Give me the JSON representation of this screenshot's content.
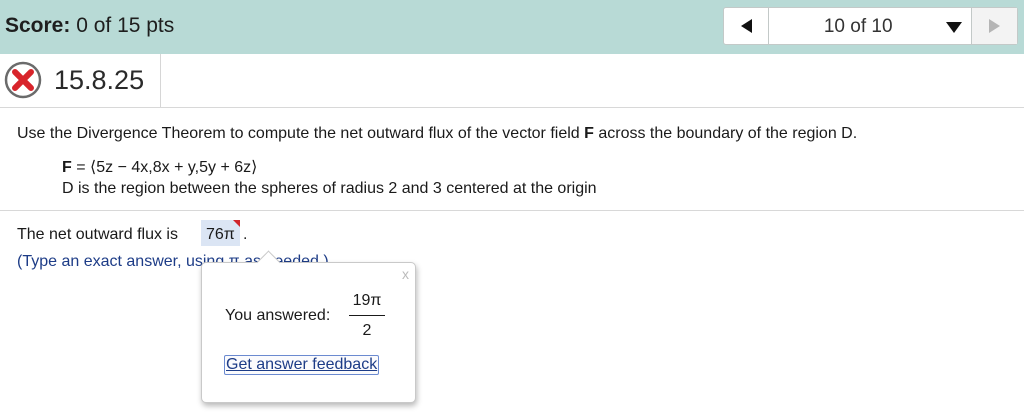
{
  "header": {
    "score_label": "Score:",
    "score_value": "0 of 15 pts",
    "question_position": "10 of 10",
    "colors": {
      "bar": "#b8dad6"
    },
    "icons": {
      "prev": "triangle-left-icon",
      "dropdown": "triangle-down-icon",
      "next": "triangle-right-icon"
    }
  },
  "question": {
    "number": "15.8.25",
    "status_icon": "incorrect-x-icon",
    "prompt_start": "Use the Divergence Theorem to compute the net outward flux of the vector field ",
    "prompt_bold": "F",
    "prompt_end": " across the boundary of the region D.",
    "field_label": "F",
    "field_expr": " = ⟨5z − 4x,8x + y,5y + 6z⟩",
    "region": "D is the region between the spheres of radius 2 and 3 centered at the origin"
  },
  "answer": {
    "line_prefix": "The net outward flux is",
    "value": "76π",
    "suffix": ".",
    "hint": "(Type an exact answer, using π as needed.)"
  },
  "popup": {
    "close": "x",
    "you_answered": "You answered:",
    "numerator": "19π",
    "denominator": "2",
    "feedback_link": "Get answer feedback"
  }
}
